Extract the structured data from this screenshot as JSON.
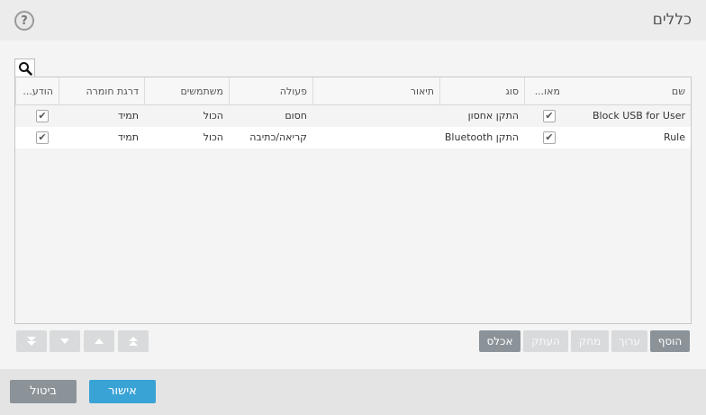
{
  "header": {
    "title": "כללים",
    "help_icon": "?"
  },
  "table": {
    "columns": [
      "שם",
      "מאו...",
      "סוג",
      "תיאור",
      "פעולה",
      "משתמשים",
      "דרגת חומרה",
      "הודע..."
    ],
    "rows": [
      {
        "name": "Block USB for User",
        "enabled": true,
        "type": "התקן אחסון",
        "description": "",
        "action": "חסום",
        "users": "הכול",
        "severity": "תמיד",
        "notify": true
      },
      {
        "name": "Rule",
        "enabled": true,
        "type": "התקן Bluetooth",
        "description": "",
        "action": "קריאה/כתיבה",
        "users": "הכול",
        "severity": "תמיד",
        "notify": true
      }
    ]
  },
  "toolbar": {
    "add": "הוסף",
    "edit": "ערוך",
    "delete": "מחק",
    "copy": "העתק",
    "populate": "אכלס"
  },
  "arrows": [
    "move-top-icon",
    "move-up-icon",
    "move-down-icon",
    "move-bottom-icon"
  ],
  "footer": {
    "ok": "אישור",
    "cancel": "ביטול"
  },
  "colors": {
    "primary": "#3aa3d6",
    "secondary": "#8b9399",
    "disabled": "#d8dadb"
  }
}
